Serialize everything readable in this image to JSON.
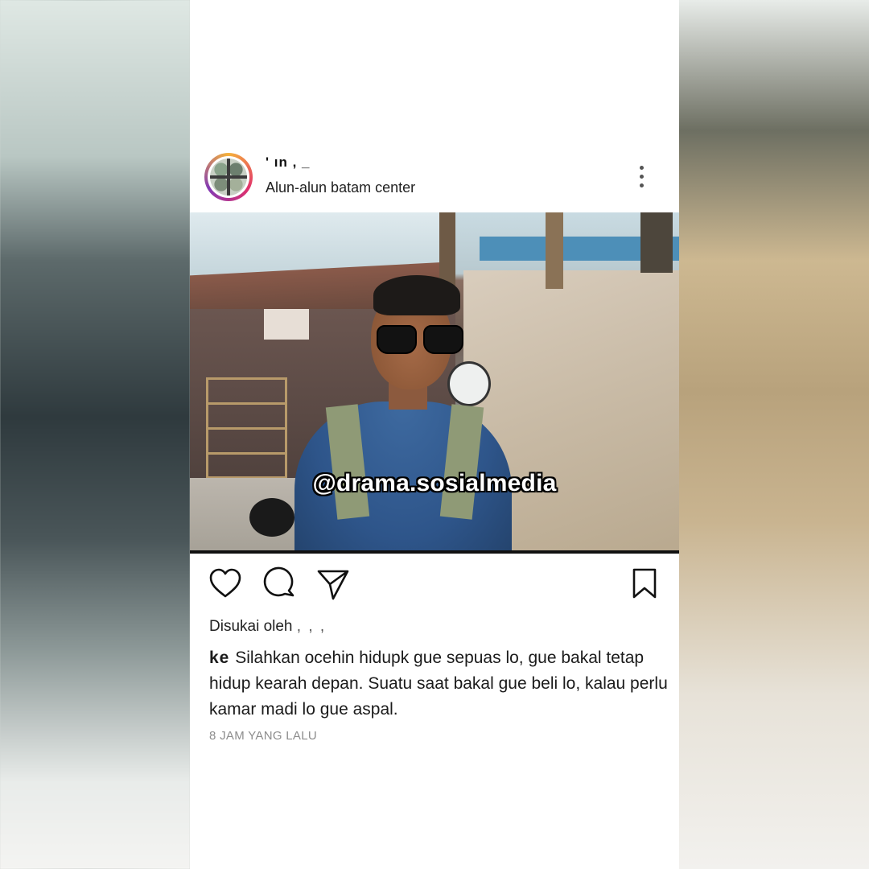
{
  "post": {
    "username": "'  ın ,  _",
    "location": "Alun-alun batam center",
    "watermark": "@drama.sosialmedia",
    "liked_by_prefix": "Disukai oleh",
    "liked_by_names": "    ,  ,  ,  ",
    "caption_user": "ke   ",
    "caption_text": "Silahkan ocehin hidupk gue sepuas lo, gue bakal tetap hidup kearah depan. Suatu saat bakal gue beli lo, kalau perlu kamar madi lo gue aspal.",
    "timestamp": "8 JAM YANG LALU"
  },
  "icons": {
    "more": "more-vertical-icon",
    "like": "heart-icon",
    "comment": "comment-icon",
    "share": "send-icon",
    "save": "bookmark-icon"
  }
}
